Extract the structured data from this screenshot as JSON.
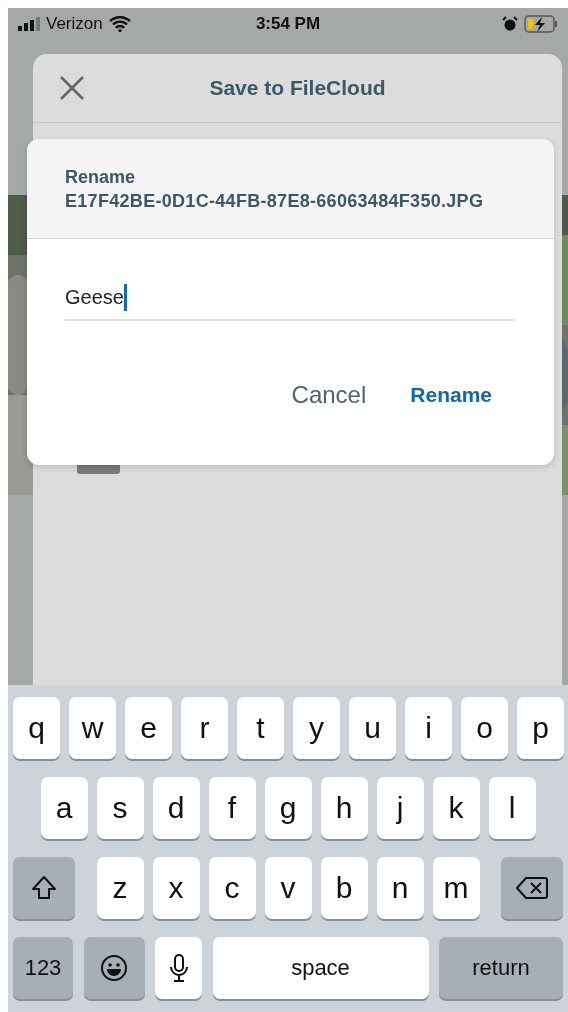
{
  "status_bar": {
    "carrier": "Verizon",
    "time": "3:54 PM"
  },
  "sheet": {
    "title": "Save to FileCloud"
  },
  "dialog": {
    "title": "Rename",
    "filename": "E17F42BE-0D1C-44FB-87E8-66063484F350.JPG",
    "value": "Geese",
    "buttons": [
      {
        "label": "Cancel",
        "kind": "secondary"
      },
      {
        "label": "Rename",
        "kind": "primary"
      }
    ]
  },
  "keyboard": {
    "rows": [
      [
        "q",
        "w",
        "e",
        "r",
        "t",
        "y",
        "u",
        "i",
        "o",
        "p"
      ],
      [
        "a",
        "s",
        "d",
        "f",
        "g",
        "h",
        "j",
        "k",
        "l"
      ],
      [
        "z",
        "x",
        "c",
        "v",
        "b",
        "n",
        "m"
      ]
    ],
    "numbers_key": "123",
    "space_key": "space",
    "return_key": "return"
  }
}
